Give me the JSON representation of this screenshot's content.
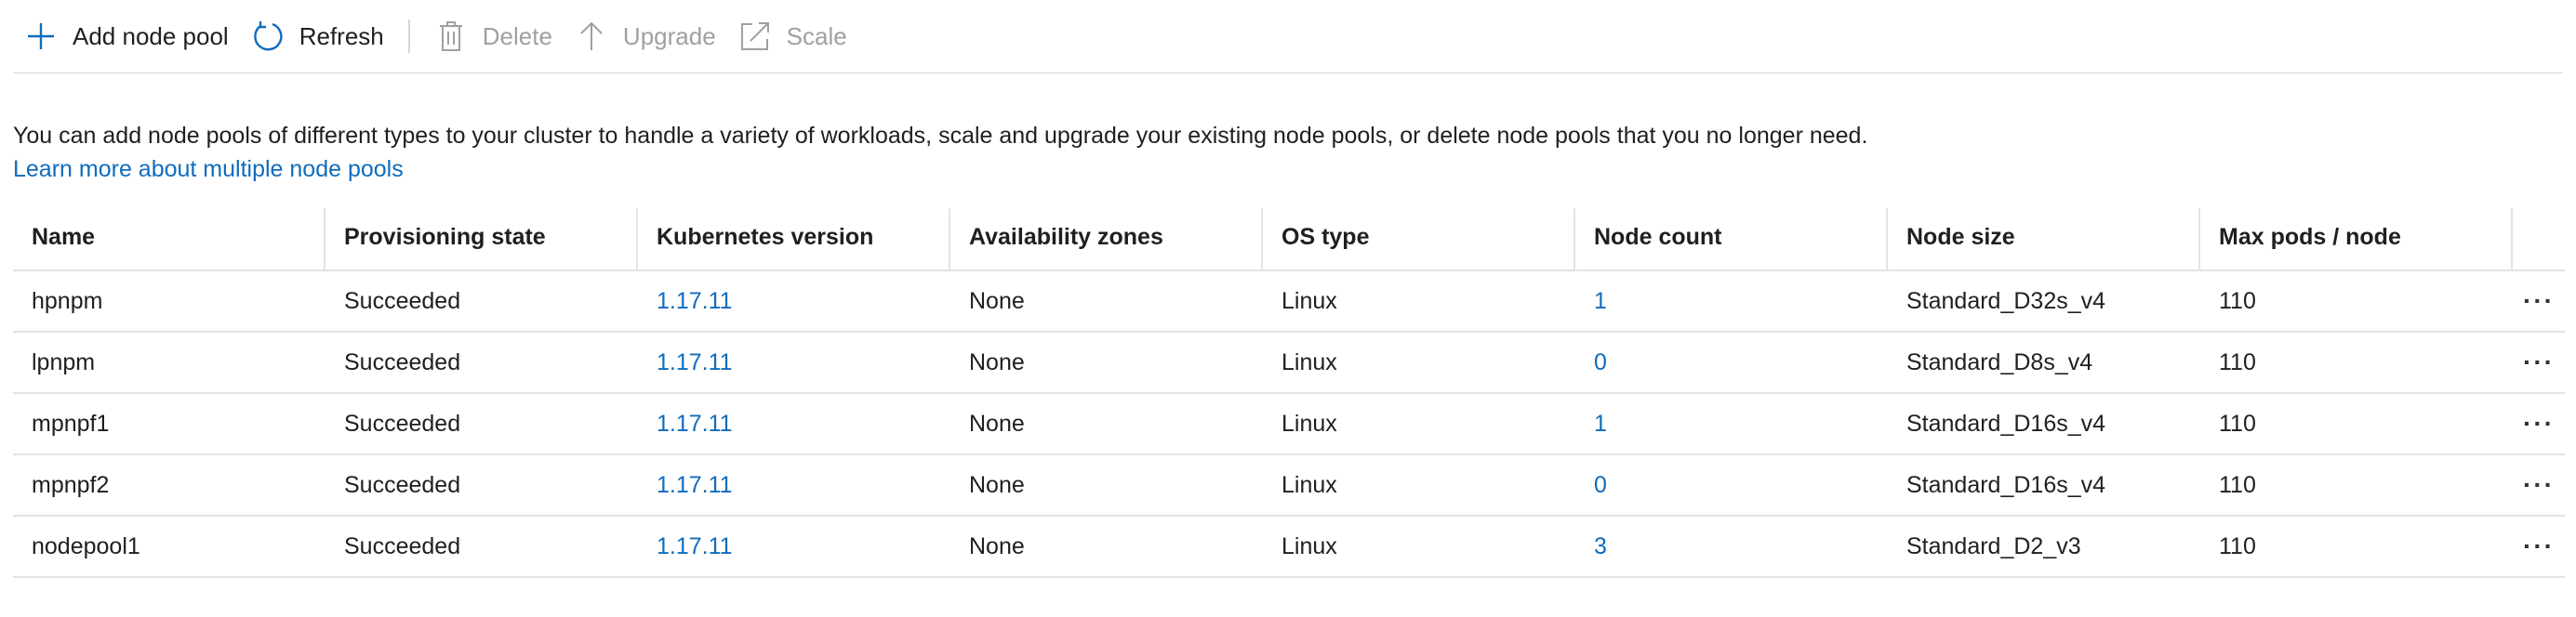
{
  "toolbar": {
    "add_label": "Add node pool",
    "refresh_label": "Refresh",
    "delete_label": "Delete",
    "upgrade_label": "Upgrade",
    "scale_label": "Scale"
  },
  "description": {
    "text": "You can add node pools of different types to your cluster to handle a variety of workloads, scale and upgrade your existing node pools, or delete node pools that you no longer need.",
    "learn_more": "Learn more about multiple node pools"
  },
  "table": {
    "columns": [
      "Name",
      "Provisioning state",
      "Kubernetes version",
      "Availability zones",
      "OS type",
      "Node count",
      "Node size",
      "Max pods / node"
    ],
    "rows": [
      {
        "name": "hpnpm",
        "state": "Succeeded",
        "version": "1.17.11",
        "zones": "None",
        "os": "Linux",
        "count": "1",
        "size": "Standard_D32s_v4",
        "pods": "110"
      },
      {
        "name": "lpnpm",
        "state": "Succeeded",
        "version": "1.17.11",
        "zones": "None",
        "os": "Linux",
        "count": "0",
        "size": "Standard_D8s_v4",
        "pods": "110"
      },
      {
        "name": "mpnpf1",
        "state": "Succeeded",
        "version": "1.17.11",
        "zones": "None",
        "os": "Linux",
        "count": "1",
        "size": "Standard_D16s_v4",
        "pods": "110"
      },
      {
        "name": "mpnpf2",
        "state": "Succeeded",
        "version": "1.17.11",
        "zones": "None",
        "os": "Linux",
        "count": "0",
        "size": "Standard_D16s_v4",
        "pods": "110"
      },
      {
        "name": "nodepool1",
        "state": "Succeeded",
        "version": "1.17.11",
        "zones": "None",
        "os": "Linux",
        "count": "3",
        "size": "Standard_D2_v3",
        "pods": "110"
      }
    ],
    "more_glyph": "···"
  },
  "colors": {
    "accent": "#0f6cbd",
    "disabled": "#a0a0a0",
    "border": "#e3e3e3"
  },
  "icons": {
    "add": "plus-icon",
    "refresh": "refresh-icon",
    "delete": "trash-icon",
    "upgrade": "arrow-up-icon",
    "scale": "scale-icon",
    "more": "more-icon"
  }
}
